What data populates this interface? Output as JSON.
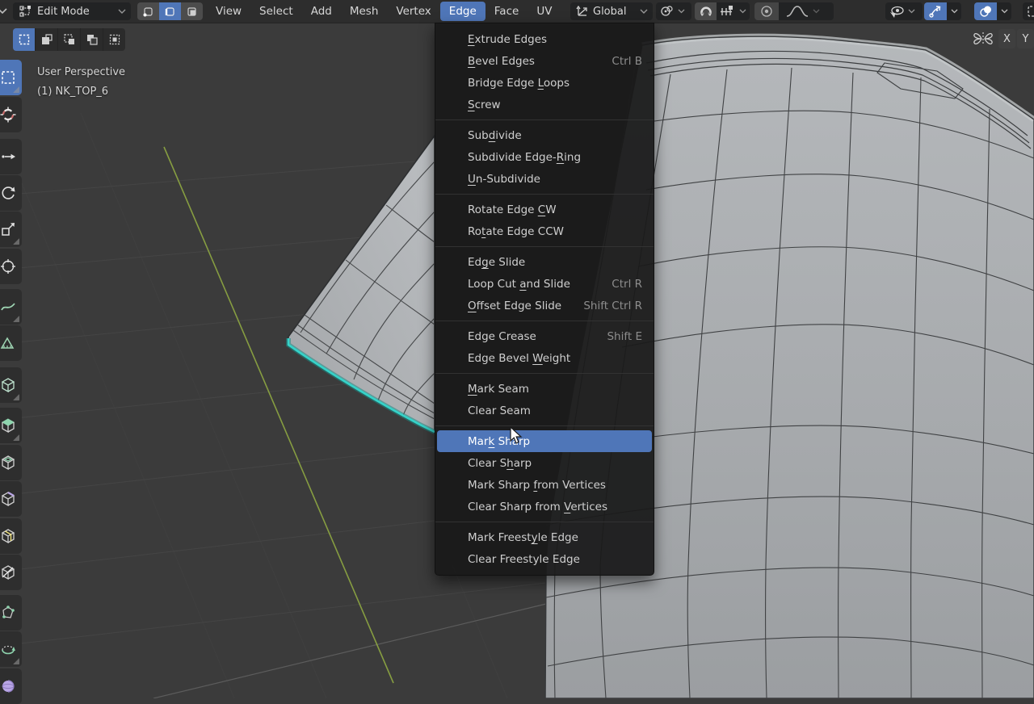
{
  "header": {
    "mode_label": "Edit Mode",
    "menus": [
      "View",
      "Select",
      "Add",
      "Mesh",
      "Vertex",
      "Edge",
      "Face",
      "UV"
    ],
    "active_menu": "Edge",
    "orientation_label": "Global",
    "icons": [
      "editor-type-chevron",
      "edit-mode-icon",
      "vertex-select-mode-icon",
      "edge-select-mode-icon",
      "face-select-mode-icon",
      "transform-orientation-icon",
      "pivot-point-icon",
      "snap-magnet-icon",
      "snap-target-icon",
      "proportional-editing-icon",
      "falloff-curve-icon",
      "object-visibility-icon",
      "gizmo-icon",
      "overlays-icon",
      "xray-icon"
    ]
  },
  "tool_settings": {
    "select_action_icons": [
      "select-set-icon",
      "select-extend-icon",
      "select-subtract-icon",
      "select-invert-icon",
      "select-intersect-icon"
    ],
    "mirror": {
      "icon": "mirror-butterfly-icon",
      "axes": [
        "X",
        "Y"
      ]
    }
  },
  "toolbar": {
    "tool_icons": [
      "select-box",
      "cursor",
      "move",
      "rotate",
      "scale",
      "transform",
      "annotate",
      "measure",
      "add-cube",
      "extrude-region",
      "inset-faces",
      "bevel",
      "loop-cut",
      "knife",
      "poly-build",
      "spin",
      "smooth"
    ],
    "active_tool": "select-box"
  },
  "viewport": {
    "overlay_line1": "User Perspective",
    "overlay_line2": "(1) NK_TOP_6"
  },
  "edge_menu": {
    "sections": [
      {
        "items": [
          {
            "label": "Extrude Edges",
            "u": 0,
            "shortcut": ""
          },
          {
            "label": "Bevel Edges",
            "u": 0,
            "shortcut": "Ctrl B"
          },
          {
            "label": "Bridge Edge Loops",
            "u": 12,
            "shortcut": ""
          },
          {
            "label": "Screw",
            "u": 0,
            "shortcut": ""
          }
        ]
      },
      {
        "items": [
          {
            "label": "Subdivide",
            "u": 3,
            "shortcut": ""
          },
          {
            "label": "Subdivide Edge-Ring",
            "u": 15,
            "shortcut": ""
          },
          {
            "label": "Un-Subdivide",
            "u": 0,
            "shortcut": ""
          }
        ]
      },
      {
        "items": [
          {
            "label": "Rotate Edge CW",
            "u": 12,
            "shortcut": ""
          },
          {
            "label": "Rotate Edge CCW",
            "u": 2,
            "shortcut": ""
          }
        ]
      },
      {
        "items": [
          {
            "label": "Edge Slide",
            "u": 2,
            "shortcut": ""
          },
          {
            "label": "Loop Cut and Slide",
            "u": 9,
            "shortcut": "Ctrl R"
          },
          {
            "label": "Offset Edge Slide",
            "u": 0,
            "shortcut": "Shift Ctrl R"
          }
        ]
      },
      {
        "items": [
          {
            "label": "Edge Crease",
            "u": -1,
            "shortcut": "Shift E"
          },
          {
            "label": "Edge Bevel Weight",
            "u": 11,
            "shortcut": ""
          }
        ]
      },
      {
        "items": [
          {
            "label": "Mark Seam",
            "u": 0,
            "shortcut": ""
          },
          {
            "label": "Clear Seam",
            "u": -1,
            "shortcut": ""
          }
        ]
      },
      {
        "items": [
          {
            "label": "Mark Sharp",
            "u": 3,
            "shortcut": "",
            "highlighted": true
          },
          {
            "label": "Clear Sharp",
            "u": 7,
            "shortcut": ""
          },
          {
            "label": "Mark Sharp from Vertices",
            "u": 11,
            "shortcut": ""
          },
          {
            "label": "Clear Sharp from Vertices",
            "u": 17,
            "shortcut": ""
          }
        ]
      },
      {
        "items": [
          {
            "label": "Mark Freestyle Edge",
            "u": 11,
            "shortcut": ""
          },
          {
            "label": "Clear Freestyle Edge",
            "u": -1,
            "shortcut": ""
          }
        ]
      }
    ]
  },
  "colors": {
    "accent_blue": "#4f76b8",
    "viewport_bg": "#3b3b3b",
    "header_bg": "#2d2d2d",
    "menu_bg": "#1a1a1a",
    "mesh_gray": "#abaeb1",
    "selected_edge_teal": "#35d3c9",
    "axis_green": "#8fa843"
  }
}
